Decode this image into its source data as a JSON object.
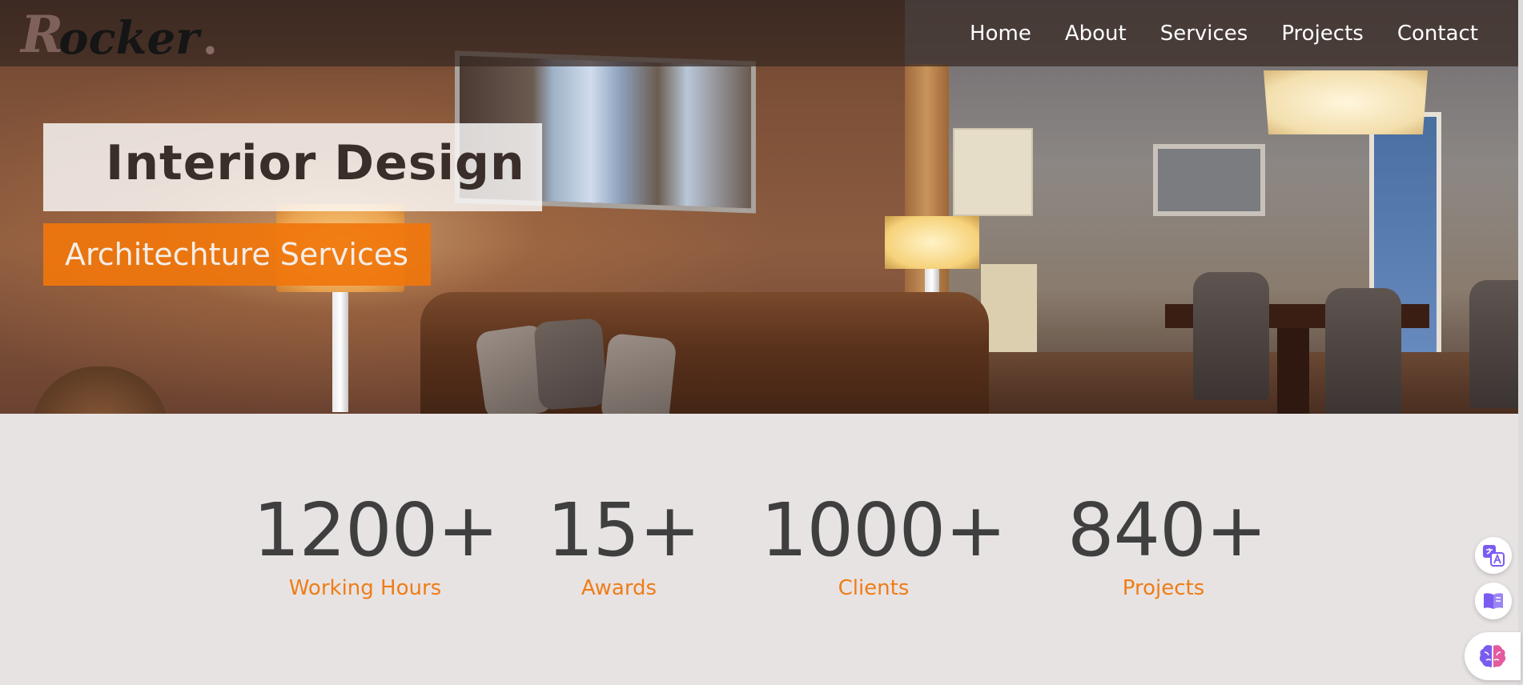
{
  "brand": {
    "logo_initial": "R",
    "logo_rest": "ocker",
    "logo_dot": "."
  },
  "nav": {
    "items": [
      {
        "label": "Home"
      },
      {
        "label": "About"
      },
      {
        "label": "Services"
      },
      {
        "label": "Projects"
      },
      {
        "label": "Contact"
      }
    ]
  },
  "hero": {
    "title": "Interior Design",
    "subtitle": "Architechture Services"
  },
  "stats": [
    {
      "number": "1200+",
      "label": "Working Hours"
    },
    {
      "number": "15+",
      "label": "Awards"
    },
    {
      "number": "1000+",
      "label": "Clients"
    },
    {
      "number": "840+",
      "label": "Projects"
    }
  ],
  "widgets": {
    "icons": [
      "translate-icon",
      "book-icon",
      "brain-icon"
    ]
  },
  "colors": {
    "accent_orange": "#f0760c",
    "stat_label": "#ee7d18",
    "stat_number": "#3f3f3f",
    "navbar_bg": "#37282266",
    "page_bg": "#e8e3e3"
  }
}
